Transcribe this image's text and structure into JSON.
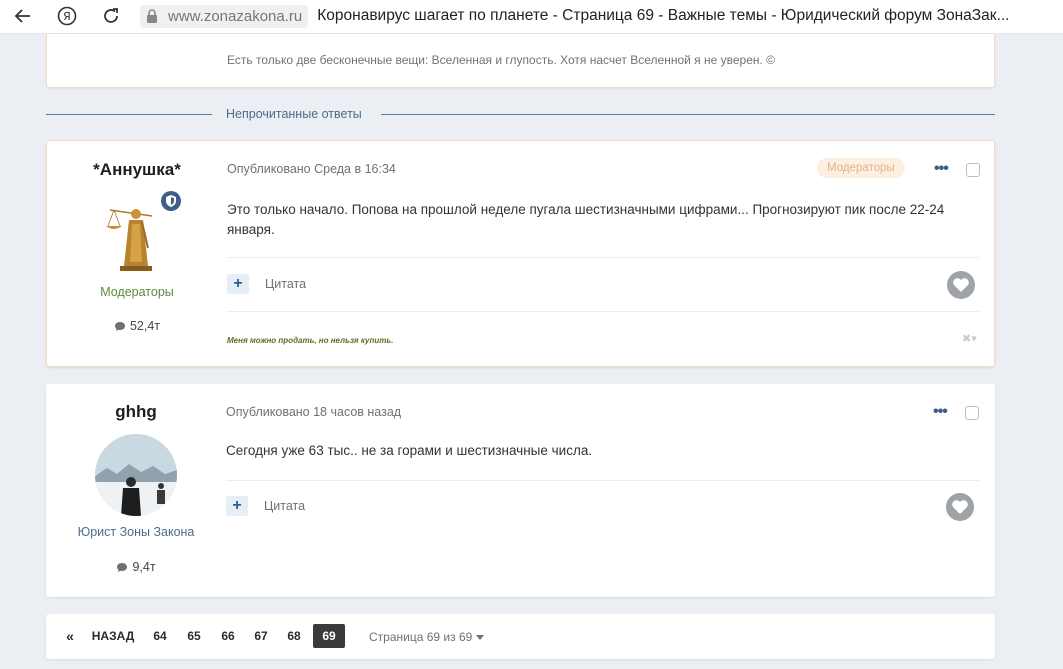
{
  "browser": {
    "domain": "www.zonazakona.ru",
    "title": "Коронавирус шагает по планете - Страница 69 - Важные темы - Юридический форум ЗонаЗак..."
  },
  "top_signature": "Есть только две бесконечные вещи: Вселенная и глупость. Хотя насчет Вселенной я не уверен. ©",
  "unread_label": "Непрочитанные ответы",
  "posts": [
    {
      "author": "*Аннушка*",
      "group": "Модераторы",
      "group_color": "#5a8a3c",
      "post_count": "52,4т",
      "meta": "Опубликовано Среда в 16:34",
      "badge": "Модераторы",
      "content": "Это только начало. Попова на прошлой неделе пугала шестизначными цифрами... Прогнозируют пик после 22-24 января.",
      "quote_label": "Цитата",
      "signature": "Меня можно продать, но нельзя купить."
    },
    {
      "author": "ghhg",
      "group": "Юрист Зоны Закона",
      "group_color": "#4b6c8f",
      "post_count": "9,4т",
      "meta": "Опубликовано 18 часов назад",
      "content": "Сегодня уже 63 тыс.. не за горами и шестизначные числа.",
      "quote_label": "Цитата"
    }
  ],
  "pagination": {
    "first": "«",
    "prev": "НАЗАД",
    "pages": [
      "64",
      "65",
      "66",
      "67",
      "68",
      "69"
    ],
    "current": "69",
    "info": "Страница 69 из 69"
  },
  "colors": {
    "accent": "#3d5f86",
    "moderator_border": "#f1dcc4",
    "background": "#ebeef2"
  }
}
